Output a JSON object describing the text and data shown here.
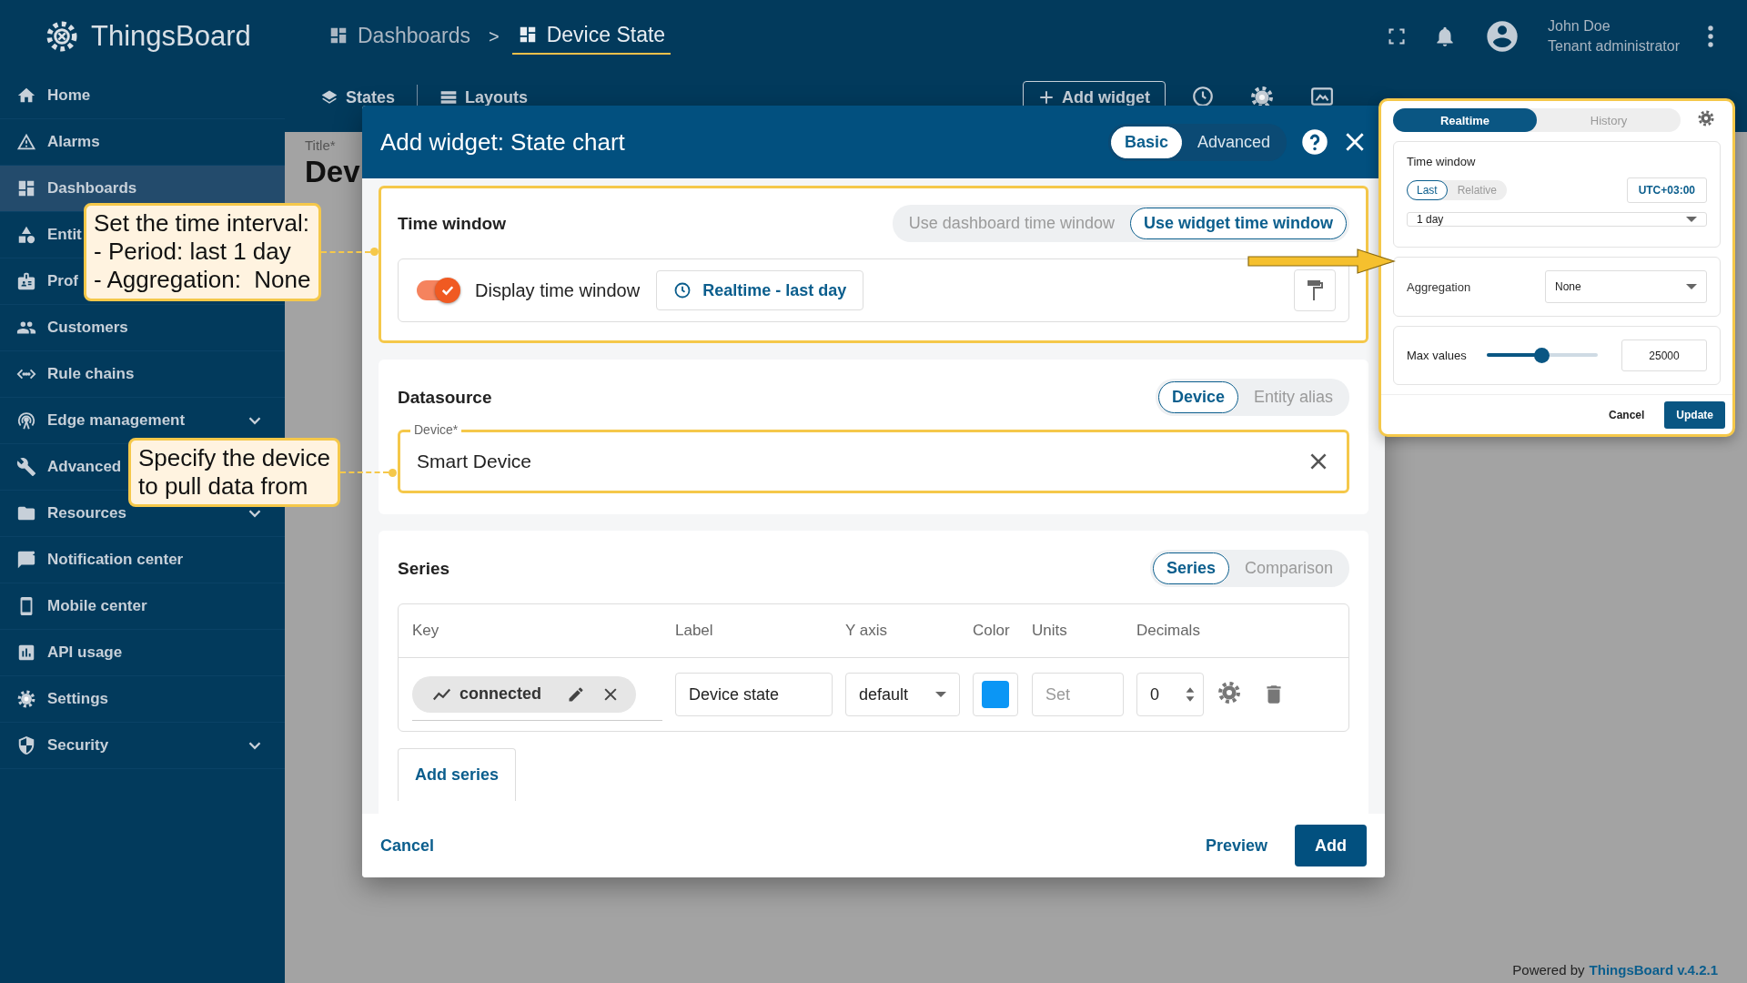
{
  "app": {
    "name": "ThingsBoard"
  },
  "breadcrumb": {
    "separator": ">",
    "items": [
      {
        "label": "Dashboards",
        "current": false
      },
      {
        "label": "Device State",
        "current": true
      }
    ]
  },
  "user": {
    "name": "John Doe",
    "role": "Tenant administrator"
  },
  "sidebar": {
    "items": [
      {
        "label": "Home",
        "selected": false,
        "expandable": false
      },
      {
        "label": "Alarms",
        "selected": false,
        "expandable": false
      },
      {
        "label": "Dashboards",
        "selected": true,
        "expandable": false
      },
      {
        "label": "Entit",
        "selected": false,
        "expandable": false
      },
      {
        "label": "Prof",
        "selected": false,
        "expandable": false
      },
      {
        "label": "Customers",
        "selected": false,
        "expandable": false
      },
      {
        "label": "Rule chains",
        "selected": false,
        "expandable": false
      },
      {
        "label": "Edge management",
        "selected": false,
        "expandable": true
      },
      {
        "label": "Advanced",
        "selected": false,
        "expandable": false
      },
      {
        "label": "Resources",
        "selected": false,
        "expandable": true
      },
      {
        "label": "Notification center",
        "selected": false,
        "expandable": false
      },
      {
        "label": "Mobile center",
        "selected": false,
        "expandable": false
      },
      {
        "label": "API usage",
        "selected": false,
        "expandable": false
      },
      {
        "label": "Settings",
        "selected": false,
        "expandable": false
      },
      {
        "label": "Security",
        "selected": false,
        "expandable": true
      }
    ]
  },
  "toolbar": {
    "states": "States",
    "layouts": "Layouts",
    "add_widget": "Add widget"
  },
  "page": {
    "title_label": "Title*",
    "title_value": "Dev"
  },
  "dialog": {
    "title_prefix": "Add widget:",
    "title": "State chart",
    "modes": [
      {
        "label": "Basic",
        "selected": true
      },
      {
        "label": "Advanced",
        "selected": false
      }
    ],
    "time_window": {
      "title": "Time window",
      "highlighted": true,
      "sources": [
        {
          "label": "Use dashboard time window",
          "selected": false
        },
        {
          "label": "Use widget time window",
          "selected": true
        }
      ],
      "display": {
        "label": "Display time window",
        "on": true
      },
      "button": "Realtime - last day"
    },
    "datasource": {
      "title": "Datasource",
      "types": [
        {
          "label": "Device",
          "selected": true
        },
        {
          "label": "Entity alias",
          "selected": false
        }
      ],
      "device": {
        "label": "Device*",
        "value": "Smart Device",
        "highlighted": true
      }
    },
    "series": {
      "title": "Series",
      "tabs": [
        {
          "label": "Series",
          "selected": true
        },
        {
          "label": "Comparison",
          "selected": false
        }
      ],
      "columns": [
        "Key",
        "Label",
        "Y axis",
        "Color",
        "Units",
        "Decimals"
      ],
      "rows": [
        {
          "key": "connected",
          "label": "Device state",
          "y_axis": "default",
          "color": "#0b96f5",
          "units_placeholder": "Set",
          "decimals": "0"
        }
      ],
      "add_button": "Add series"
    },
    "actions": {
      "cancel": "Cancel",
      "preview": "Preview",
      "add": "Add"
    }
  },
  "timewindow_popup": {
    "modes": [
      {
        "label": "Realtime",
        "selected": true
      },
      {
        "label": "History",
        "selected": false
      }
    ],
    "time_window": {
      "title": "Time window",
      "types": [
        {
          "label": "Last",
          "selected": true
        },
        {
          "label": "Relative",
          "selected": false
        }
      ],
      "timezone": "UTC+03:00",
      "interval": "1 day"
    },
    "aggregation": {
      "label": "Aggregation",
      "value": "None"
    },
    "max_values": {
      "label": "Max values",
      "level": 0.5,
      "value": "25000"
    },
    "cancel": "Cancel",
    "update": "Update"
  },
  "callouts": [
    {
      "text": "Set the time interval:\n- Period: last 1 day\n- Aggregation:  None"
    },
    {
      "text": "Specify the device\nto pull data from"
    }
  ],
  "footer": {
    "prefix": "Powered by",
    "link": "ThingsBoard v.4.2.1"
  }
}
